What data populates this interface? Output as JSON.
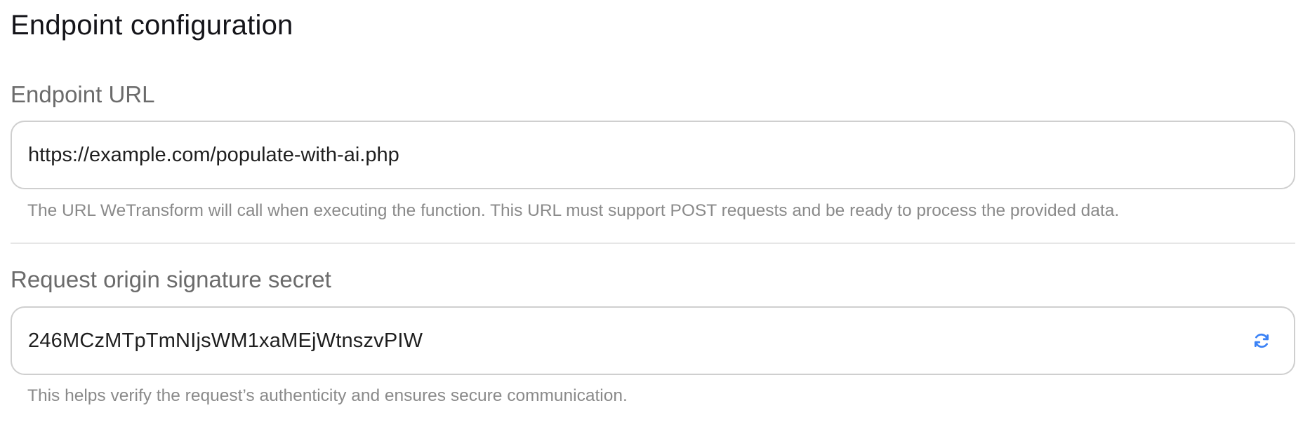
{
  "section": {
    "title": "Endpoint configuration"
  },
  "endpoint_url": {
    "label": "Endpoint URL",
    "value": "https://example.com/populate-with-ai.php",
    "help": "The URL WeTransform will call when executing the function. This URL must support POST requests and be ready to process the provided data."
  },
  "signature_secret": {
    "label": "Request origin signature secret",
    "value": "246MCzMTpTmNIjsWM1xaMEjWtnszvPIW",
    "help": "This helps verify the request’s authenticity and ensures secure communication.",
    "action_icon": "refresh-icon"
  },
  "colors": {
    "accent": "#3b82f6",
    "label": "#6b6b6b",
    "help": "#8a8a8a",
    "border": "#cfcfcf"
  }
}
